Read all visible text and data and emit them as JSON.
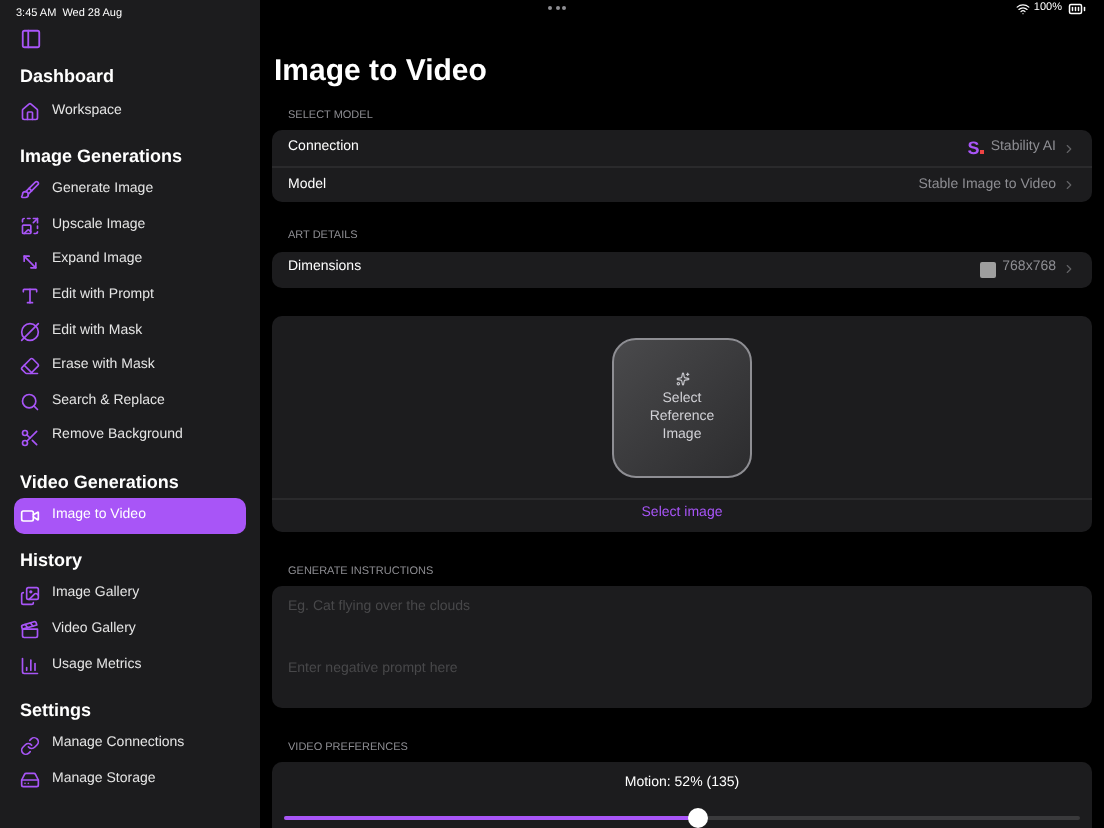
{
  "status_bar": {
    "time": "3:45 AM",
    "date": "Wed 28 Aug",
    "battery": "100%"
  },
  "sidebar": {
    "sections": [
      {
        "title": "Dashboard",
        "items": [
          {
            "label": "Workspace",
            "selected": false
          }
        ]
      },
      {
        "title": "Image Generations",
        "items": [
          {
            "label": "Generate Image",
            "selected": false
          },
          {
            "label": "Upscale Image",
            "selected": false
          },
          {
            "label": "Expand Image",
            "selected": false
          },
          {
            "label": "Edit with Prompt",
            "selected": false
          },
          {
            "label": "Edit with Mask",
            "selected": false
          },
          {
            "label": "Erase with Mask",
            "selected": false
          },
          {
            "label": "Search & Replace",
            "selected": false
          },
          {
            "label": "Remove Background",
            "selected": false
          }
        ]
      },
      {
        "title": "Video Generations",
        "items": [
          {
            "label": "Image to Video",
            "selected": true
          }
        ]
      },
      {
        "title": "History",
        "items": [
          {
            "label": "Image Gallery",
            "selected": false
          },
          {
            "label": "Video Gallery",
            "selected": false
          },
          {
            "label": "Usage Metrics",
            "selected": false
          }
        ]
      },
      {
        "title": "Settings",
        "items": [
          {
            "label": "Manage Connections",
            "selected": false
          },
          {
            "label": "Manage Storage",
            "selected": false
          }
        ]
      }
    ]
  },
  "page": {
    "title": "Image to Video",
    "select_model": {
      "header": "SELECT MODEL",
      "rows": [
        {
          "label": "Connection",
          "logo": "S",
          "value": "Stability AI"
        },
        {
          "label": "Model",
          "value": "Stable Image to Video"
        }
      ]
    },
    "art_details": {
      "header": "ART DETAILS",
      "rows": [
        {
          "label": "Dimensions",
          "value": "768x768"
        }
      ]
    },
    "reference": {
      "tile_label": "Select Reference Image",
      "link": "Select image"
    },
    "instructions": {
      "header": "GENERATE INSTRUCTIONS",
      "prompt_placeholder": "Eg. Cat flying over the clouds",
      "negative_placeholder": "Enter negative prompt here"
    },
    "video_preferences": {
      "header": "VIDEO PREFERENCES",
      "motion_label": "Motion: 52% (135)",
      "level": 0.52
    }
  }
}
